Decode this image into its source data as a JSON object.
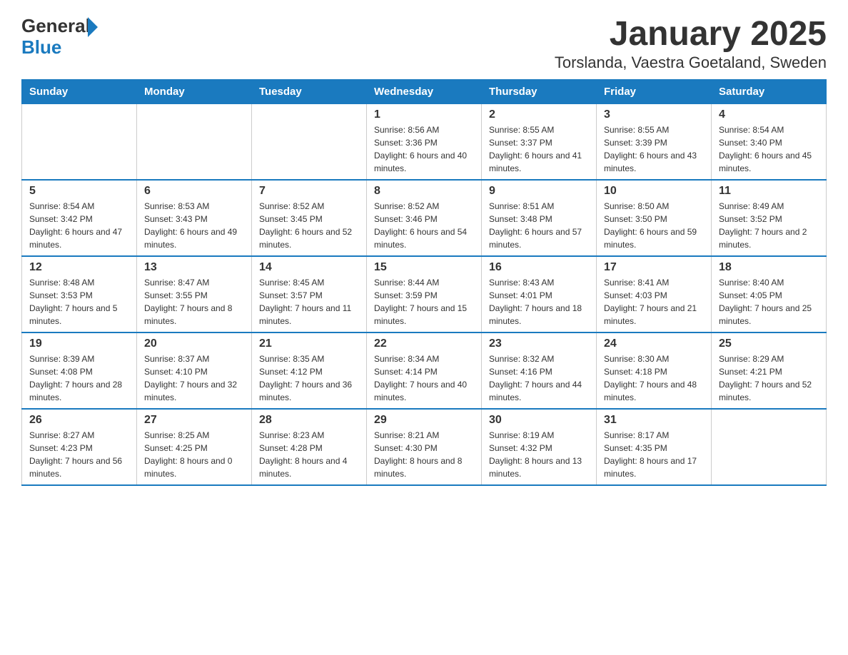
{
  "logo": {
    "general": "General",
    "blue": "Blue"
  },
  "title": "January 2025",
  "subtitle": "Torslanda, Vaestra Goetaland, Sweden",
  "days_of_week": [
    "Sunday",
    "Monday",
    "Tuesday",
    "Wednesday",
    "Thursday",
    "Friday",
    "Saturday"
  ],
  "weeks": [
    [
      {
        "day": "",
        "info": ""
      },
      {
        "day": "",
        "info": ""
      },
      {
        "day": "",
        "info": ""
      },
      {
        "day": "1",
        "info": "Sunrise: 8:56 AM\nSunset: 3:36 PM\nDaylight: 6 hours and 40 minutes."
      },
      {
        "day": "2",
        "info": "Sunrise: 8:55 AM\nSunset: 3:37 PM\nDaylight: 6 hours and 41 minutes."
      },
      {
        "day": "3",
        "info": "Sunrise: 8:55 AM\nSunset: 3:39 PM\nDaylight: 6 hours and 43 minutes."
      },
      {
        "day": "4",
        "info": "Sunrise: 8:54 AM\nSunset: 3:40 PM\nDaylight: 6 hours and 45 minutes."
      }
    ],
    [
      {
        "day": "5",
        "info": "Sunrise: 8:54 AM\nSunset: 3:42 PM\nDaylight: 6 hours and 47 minutes."
      },
      {
        "day": "6",
        "info": "Sunrise: 8:53 AM\nSunset: 3:43 PM\nDaylight: 6 hours and 49 minutes."
      },
      {
        "day": "7",
        "info": "Sunrise: 8:52 AM\nSunset: 3:45 PM\nDaylight: 6 hours and 52 minutes."
      },
      {
        "day": "8",
        "info": "Sunrise: 8:52 AM\nSunset: 3:46 PM\nDaylight: 6 hours and 54 minutes."
      },
      {
        "day": "9",
        "info": "Sunrise: 8:51 AM\nSunset: 3:48 PM\nDaylight: 6 hours and 57 minutes."
      },
      {
        "day": "10",
        "info": "Sunrise: 8:50 AM\nSunset: 3:50 PM\nDaylight: 6 hours and 59 minutes."
      },
      {
        "day": "11",
        "info": "Sunrise: 8:49 AM\nSunset: 3:52 PM\nDaylight: 7 hours and 2 minutes."
      }
    ],
    [
      {
        "day": "12",
        "info": "Sunrise: 8:48 AM\nSunset: 3:53 PM\nDaylight: 7 hours and 5 minutes."
      },
      {
        "day": "13",
        "info": "Sunrise: 8:47 AM\nSunset: 3:55 PM\nDaylight: 7 hours and 8 minutes."
      },
      {
        "day": "14",
        "info": "Sunrise: 8:45 AM\nSunset: 3:57 PM\nDaylight: 7 hours and 11 minutes."
      },
      {
        "day": "15",
        "info": "Sunrise: 8:44 AM\nSunset: 3:59 PM\nDaylight: 7 hours and 15 minutes."
      },
      {
        "day": "16",
        "info": "Sunrise: 8:43 AM\nSunset: 4:01 PM\nDaylight: 7 hours and 18 minutes."
      },
      {
        "day": "17",
        "info": "Sunrise: 8:41 AM\nSunset: 4:03 PM\nDaylight: 7 hours and 21 minutes."
      },
      {
        "day": "18",
        "info": "Sunrise: 8:40 AM\nSunset: 4:05 PM\nDaylight: 7 hours and 25 minutes."
      }
    ],
    [
      {
        "day": "19",
        "info": "Sunrise: 8:39 AM\nSunset: 4:08 PM\nDaylight: 7 hours and 28 minutes."
      },
      {
        "day": "20",
        "info": "Sunrise: 8:37 AM\nSunset: 4:10 PM\nDaylight: 7 hours and 32 minutes."
      },
      {
        "day": "21",
        "info": "Sunrise: 8:35 AM\nSunset: 4:12 PM\nDaylight: 7 hours and 36 minutes."
      },
      {
        "day": "22",
        "info": "Sunrise: 8:34 AM\nSunset: 4:14 PM\nDaylight: 7 hours and 40 minutes."
      },
      {
        "day": "23",
        "info": "Sunrise: 8:32 AM\nSunset: 4:16 PM\nDaylight: 7 hours and 44 minutes."
      },
      {
        "day": "24",
        "info": "Sunrise: 8:30 AM\nSunset: 4:18 PM\nDaylight: 7 hours and 48 minutes."
      },
      {
        "day": "25",
        "info": "Sunrise: 8:29 AM\nSunset: 4:21 PM\nDaylight: 7 hours and 52 minutes."
      }
    ],
    [
      {
        "day": "26",
        "info": "Sunrise: 8:27 AM\nSunset: 4:23 PM\nDaylight: 7 hours and 56 minutes."
      },
      {
        "day": "27",
        "info": "Sunrise: 8:25 AM\nSunset: 4:25 PM\nDaylight: 8 hours and 0 minutes."
      },
      {
        "day": "28",
        "info": "Sunrise: 8:23 AM\nSunset: 4:28 PM\nDaylight: 8 hours and 4 minutes."
      },
      {
        "day": "29",
        "info": "Sunrise: 8:21 AM\nSunset: 4:30 PM\nDaylight: 8 hours and 8 minutes."
      },
      {
        "day": "30",
        "info": "Sunrise: 8:19 AM\nSunset: 4:32 PM\nDaylight: 8 hours and 13 minutes."
      },
      {
        "day": "31",
        "info": "Sunrise: 8:17 AM\nSunset: 4:35 PM\nDaylight: 8 hours and 17 minutes."
      },
      {
        "day": "",
        "info": ""
      }
    ]
  ]
}
